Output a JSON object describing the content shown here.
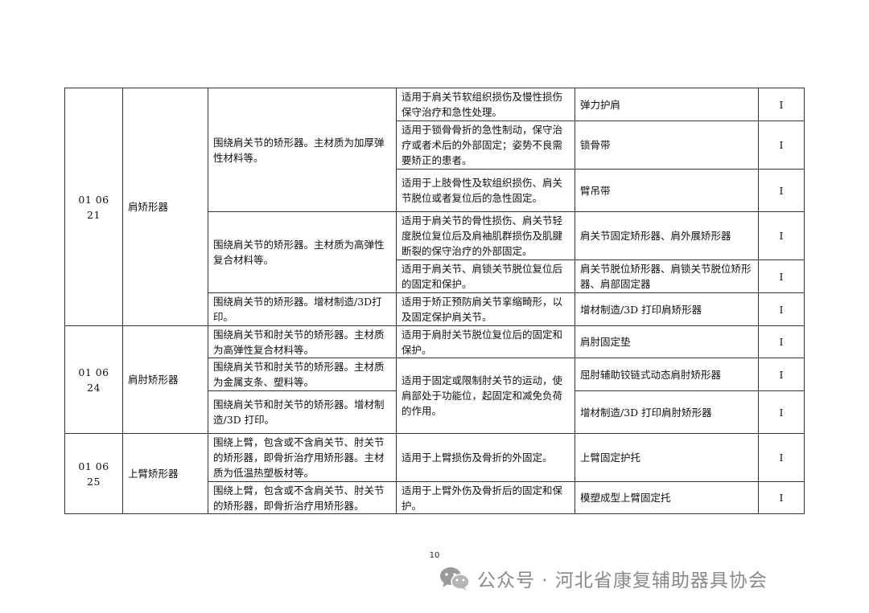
{
  "groups": [
    {
      "code": "01 06 21",
      "name": "肩矫形器",
      "rows": [
        {
          "desc": "围绕肩关节的矫形器。主材质为加厚弹性材料等。",
          "use": "适用于肩关节软组织损伤及慢性损伤保守治疗和急性处理。",
          "example": "弹力护肩",
          "class": "I"
        },
        {
          "use": "适用于锁骨骨折的急性制动，保守治疗或者术后的外部固定；姿势不良需要矫正的患者。",
          "example": "锁骨带",
          "class": "I"
        },
        {
          "use": "适用于上肢骨性及软组织损伤、肩关节脱位或者复位后的急性固定。",
          "example": "臂吊带",
          "class": "I"
        },
        {
          "desc": "围绕肩关节的矫形器。主材质为高弹性复合材料等。",
          "use": "适用于肩关节的骨性损伤、肩关节轻度脱位复位后及肩袖肌群损伤及肌腱断裂的保守治疗的外部固定。",
          "example": "肩关节固定矫形器、肩外展矫形器",
          "class": "I"
        },
        {
          "use": "适用于肩关节、肩锁关节脱位复位后的固定和保护。",
          "example": "肩关节脱位矫形器、肩锁关节脱位矫形器、肩部固定器",
          "class": "I"
        },
        {
          "desc": "围绕肩关节的矫形器。增材制造/3D打印。",
          "use": "适用于矫正预防肩关节挛缩畸形，以及固定保护肩关节。",
          "example": "增材制造/3D 打印肩矫形器",
          "class": "I"
        }
      ]
    },
    {
      "code": "01 06 24",
      "name": "肩肘矫形器",
      "rows": [
        {
          "desc": "围绕肩关节和肘关节的矫形器。主材质为高弹性复合材料等。",
          "use": "适用于肩肘关节脱位复位后的固定和保护。",
          "example": "肩肘固定垫",
          "class": "I"
        },
        {
          "desc": "围绕肩关节和肘关节的矫形器。主材质为金属支条、塑料等。",
          "use": "适用于固定或限制肘关节的运动，使肩部处于功能位，起固定和减免负荷的作用。",
          "example": "屈肘辅助铰链式动态肩肘矫形器",
          "class": "I"
        },
        {
          "desc": "围绕肩关节和肘关节的矫形器。增材制造/3D 打印。",
          "example": "增材制造/3D 打印肩肘矫形器",
          "class": "I"
        }
      ]
    },
    {
      "code": "01 06 25",
      "name": "上臂矫形器",
      "rows": [
        {
          "desc": "围绕上臂，包含或不含肩关节、肘关节的矫形器，即骨折治疗用矫形器。主材质为低温热塑板材等。",
          "use": "适用于上臂损伤及骨折的外固定。",
          "example": "上臂固定护托",
          "class": "I"
        },
        {
          "desc": "围绕上臂，包含或不含肩关节、肘关节的矫形器，即骨折治疗用矫形器。",
          "use": "适用于上臂外伤及骨折后的固定和保护。",
          "example": "模塑成型上臂固定托",
          "class": "I"
        }
      ]
    }
  ],
  "footer": {
    "page_number": "10",
    "watermark": "公众号 · 河北省康复辅助器具协会",
    "watermark_icon": "wechat-icon"
  }
}
